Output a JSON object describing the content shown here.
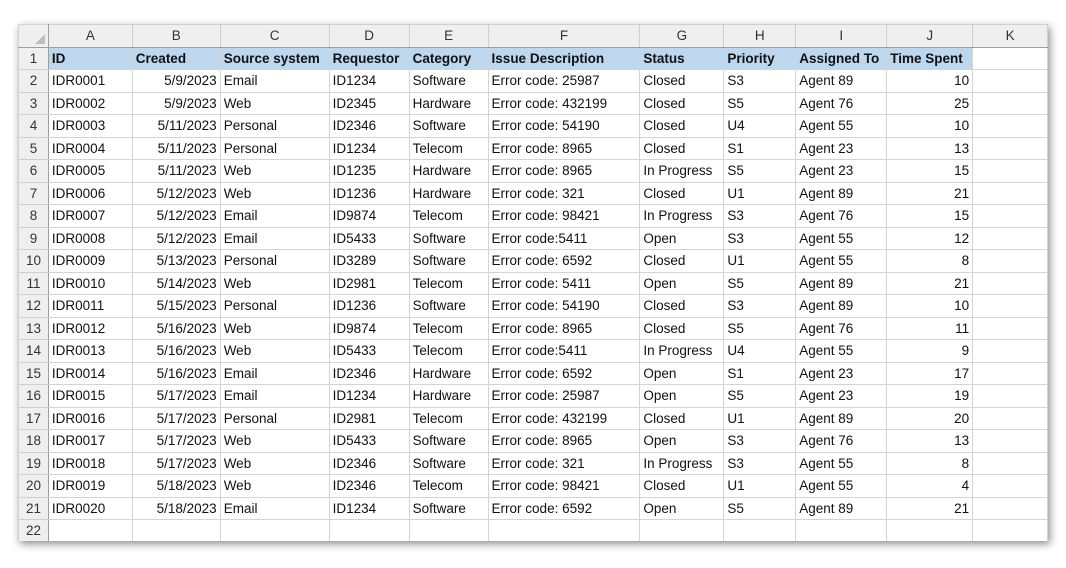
{
  "columns": [
    "A",
    "B",
    "C",
    "D",
    "E",
    "F",
    "G",
    "H",
    "I",
    "J",
    "K"
  ],
  "headers": [
    "ID",
    "Created",
    "Source system",
    "Requestor",
    "Category",
    "Issue Description",
    "Status",
    "Priority",
    "Assigned To",
    "Time Spent"
  ],
  "header_fill": "#bdd7ee",
  "rows": [
    [
      "IDR0001",
      "5/9/2023",
      "Email",
      "ID1234",
      "Software",
      "Error code: 25987",
      "Closed",
      "S3",
      "Agent 89",
      "10"
    ],
    [
      "IDR0002",
      "5/9/2023",
      "Web",
      "ID2345",
      "Hardware",
      "Error code: 432199",
      "Closed",
      "S5",
      "Agent 76",
      "25"
    ],
    [
      "IDR0003",
      "5/11/2023",
      "Personal",
      "ID2346",
      "Software",
      "Error code: 54190",
      "Closed",
      "U4",
      "Agent 55",
      "10"
    ],
    [
      "IDR0004",
      "5/11/2023",
      "Personal",
      "ID1234",
      "Telecom",
      "Error code: 8965",
      "Closed",
      "S1",
      "Agent 23",
      "13"
    ],
    [
      "IDR0005",
      "5/11/2023",
      "Web",
      "ID1235",
      "Hardware",
      "Error code: 8965",
      "In Progress",
      "S5",
      "Agent 23",
      "15"
    ],
    [
      "IDR0006",
      "5/12/2023",
      "Web",
      "ID1236",
      "Hardware",
      "Error code: 321",
      "Closed",
      "U1",
      "Agent 89",
      "21"
    ],
    [
      "IDR0007",
      "5/12/2023",
      "Email",
      "ID9874",
      "Telecom",
      "Error code: 98421",
      "In Progress",
      "S3",
      "Agent 76",
      "15"
    ],
    [
      "IDR0008",
      "5/12/2023",
      "Email",
      "ID5433",
      "Software",
      "Error code:5411",
      "Open",
      "S3",
      "Agent 55",
      "12"
    ],
    [
      "IDR0009",
      "5/13/2023",
      "Personal",
      "ID3289",
      "Software",
      "Error code: 6592",
      "Closed",
      "U1",
      "Agent 55",
      "8"
    ],
    [
      "IDR0010",
      "5/14/2023",
      "Web",
      "ID2981",
      "Telecom",
      "Error code: 5411",
      "Open",
      "S5",
      "Agent 89",
      "21"
    ],
    [
      "IDR0011",
      "5/15/2023",
      "Personal",
      "ID1236",
      "Software",
      "Error code: 54190",
      "Closed",
      "S3",
      "Agent 89",
      "10"
    ],
    [
      "IDR0012",
      "5/16/2023",
      "Web",
      "ID9874",
      "Telecom",
      "Error code: 8965",
      "Closed",
      "S5",
      "Agent 76",
      "11"
    ],
    [
      "IDR0013",
      "5/16/2023",
      "Web",
      "ID5433",
      "Telecom",
      "Error code:5411",
      "In Progress",
      "U4",
      "Agent 55",
      "9"
    ],
    [
      "IDR0014",
      "5/16/2023",
      "Email",
      "ID2346",
      "Hardware",
      "Error code: 6592",
      "Open",
      "S1",
      "Agent 23",
      "17"
    ],
    [
      "IDR0015",
      "5/17/2023",
      "Email",
      "ID1234",
      "Hardware",
      "Error code: 25987",
      "Open",
      "S5",
      "Agent 23",
      "19"
    ],
    [
      "IDR0016",
      "5/17/2023",
      "Personal",
      "ID2981",
      "Telecom",
      "Error code: 432199",
      "Closed",
      "U1",
      "Agent 89",
      "20"
    ],
    [
      "IDR0017",
      "5/17/2023",
      "Web",
      "ID5433",
      "Software",
      "Error code: 8965",
      "Open",
      "S3",
      "Agent 76",
      "13"
    ],
    [
      "IDR0018",
      "5/17/2023",
      "Web",
      "ID2346",
      "Software",
      "Error code: 321",
      "In Progress",
      "S3",
      "Agent 55",
      "8"
    ],
    [
      "IDR0019",
      "5/18/2023",
      "Web",
      "ID2346",
      "Telecom",
      "Error code: 98421",
      "Closed",
      "U1",
      "Agent 55",
      "4"
    ],
    [
      "IDR0020",
      "5/18/2023",
      "Email",
      "ID1234",
      "Software",
      "Error code: 6592",
      "Open",
      "S5",
      "Agent 89",
      "21"
    ]
  ],
  "row_numbers": [
    "1",
    "2",
    "3",
    "4",
    "5",
    "6",
    "7",
    "8",
    "9",
    "10",
    "11",
    "12",
    "13",
    "14",
    "15",
    "16",
    "17",
    "18",
    "19",
    "20",
    "21",
    "22"
  ]
}
